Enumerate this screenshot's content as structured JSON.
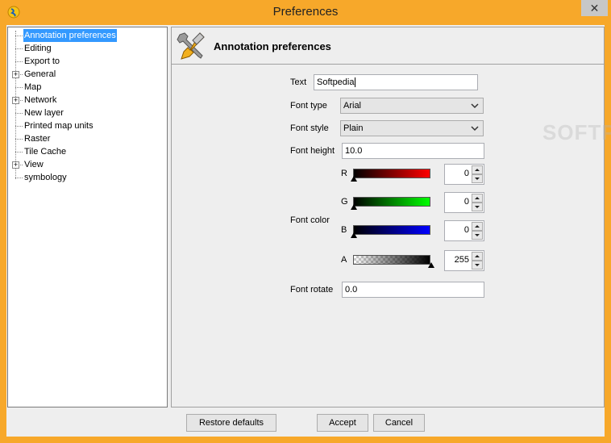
{
  "window": {
    "title": "Preferences",
    "close_glyph": "✕",
    "accent_color": "#f7a82a"
  },
  "tree": {
    "items": [
      {
        "label": "Annotation preferences",
        "expandable": false,
        "selected": true
      },
      {
        "label": "Editing",
        "expandable": false
      },
      {
        "label": "Export to",
        "expandable": false
      },
      {
        "label": "General",
        "expandable": true
      },
      {
        "label": "Map",
        "expandable": false
      },
      {
        "label": "Network",
        "expandable": true
      },
      {
        "label": "New layer",
        "expandable": false
      },
      {
        "label": "Printed map units",
        "expandable": false
      },
      {
        "label": "Raster",
        "expandable": false
      },
      {
        "label": "Tile Cache",
        "expandable": false
      },
      {
        "label": "View",
        "expandable": true
      },
      {
        "label": "symbology",
        "expandable": false
      }
    ],
    "expander_glyph": "+",
    "selection_color": "#3399ff"
  },
  "panel": {
    "title": "Annotation preferences",
    "header_icon": "tools-icon",
    "text_label": "Text",
    "text_value": "Softpedia",
    "font_type_label": "Font type",
    "font_type_value": "Arial",
    "font_style_label": "Font style",
    "font_style_value": "Plain",
    "font_height_label": "Font height",
    "font_height_value": "10.0",
    "font_color_label": "Font color",
    "channels": [
      {
        "name": "R",
        "value": "0",
        "level": 0.0,
        "color": "#ff0000"
      },
      {
        "name": "G",
        "value": "0",
        "level": 0.0,
        "color": "#00ff00"
      },
      {
        "name": "B",
        "value": "0",
        "level": 0.0,
        "color": "#0000ff"
      },
      {
        "name": "A",
        "value": "255",
        "level": 1.0,
        "color": "#000000"
      }
    ],
    "font_rotate_label": "Font rotate",
    "font_rotate_value": "0.0"
  },
  "buttons": {
    "restore": "Restore defaults",
    "accept": "Accept",
    "cancel": "Cancel"
  },
  "watermark": "SOFTPEDIA"
}
